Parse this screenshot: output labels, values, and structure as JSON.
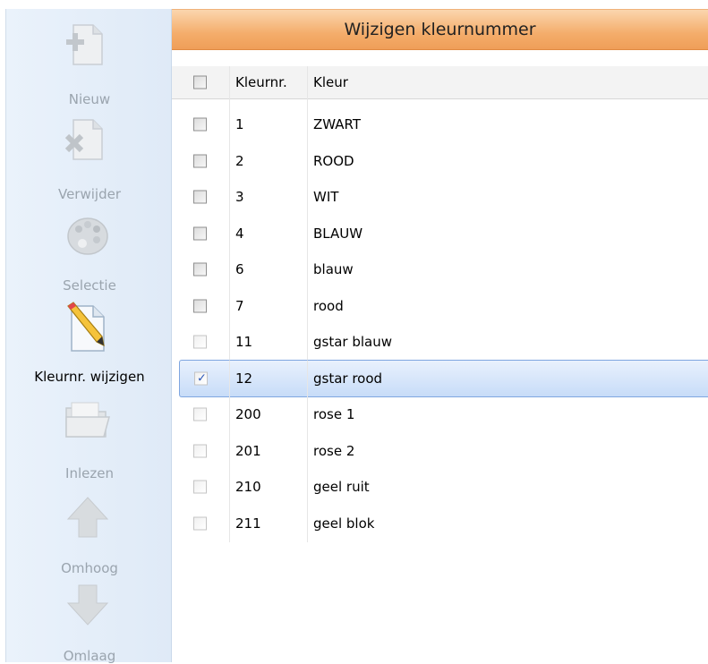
{
  "window": {
    "title": "Wijzigen kleurnummer"
  },
  "sidebar": {
    "items": [
      {
        "label": "Nieuw",
        "icon": "new-document-icon",
        "active": false
      },
      {
        "label": "Verwijder",
        "icon": "delete-document-icon",
        "active": false
      },
      {
        "label": "Selectie",
        "icon": "palette-icon",
        "active": false
      },
      {
        "label": "Kleurnr. wijzigen",
        "icon": "pencil-edit-icon",
        "active": true
      },
      {
        "label": "Inlezen",
        "icon": "folder-open-icon",
        "active": false
      },
      {
        "label": "Omhoog",
        "icon": "arrow-up-icon",
        "active": false
      },
      {
        "label": "Omlaag",
        "icon": "arrow-down-icon",
        "active": false
      }
    ]
  },
  "table": {
    "columns": [
      "Kleurnr.",
      "Kleur"
    ],
    "rows": [
      {
        "nr": "1",
        "kleur": "ZWART",
        "checked": false
      },
      {
        "nr": "2",
        "kleur": "ROOD",
        "checked": false
      },
      {
        "nr": "3",
        "kleur": "WIT",
        "checked": false
      },
      {
        "nr": "4",
        "kleur": "BLAUW",
        "checked": false
      },
      {
        "nr": "6",
        "kleur": "blauw",
        "checked": false
      },
      {
        "nr": "7",
        "kleur": "rood",
        "checked": false
      },
      {
        "nr": "11",
        "kleur": "gstar blauw",
        "checked": false
      },
      {
        "nr": "12",
        "kleur": "gstar rood",
        "checked": true,
        "selected": true
      },
      {
        "nr": "200",
        "kleur": "rose 1",
        "checked": false
      },
      {
        "nr": "201",
        "kleur": "rose 2",
        "checked": false
      },
      {
        "nr": "210",
        "kleur": "geel ruit",
        "checked": false
      },
      {
        "nr": "211",
        "kleur": "geel blok",
        "checked": false
      }
    ]
  },
  "colors": {
    "title_bar": "#f4ad6b",
    "sidebar_bg": "#e4eef9",
    "selection": "#c7dcf8",
    "check_mark": "#2a56b8"
  }
}
